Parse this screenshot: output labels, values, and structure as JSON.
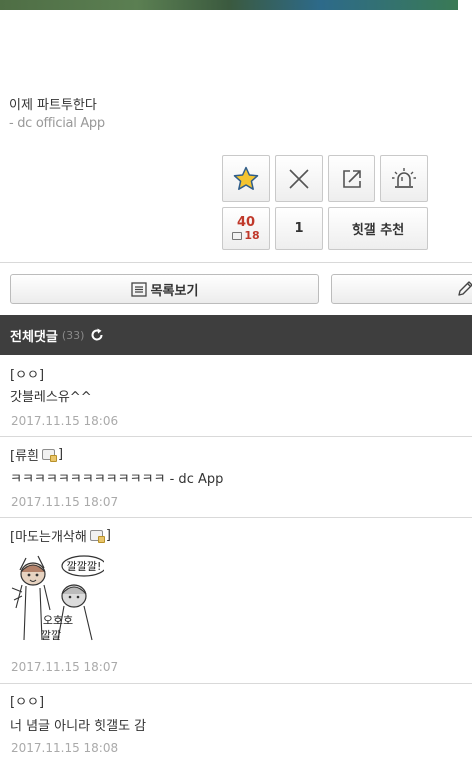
{
  "post": {
    "text": "이제 파트투한다",
    "signature": "- dc official App"
  },
  "vote": {
    "recommend_icon": "star-icon",
    "report_icon": "close-x-icon",
    "share_icon": "share-icon",
    "alert_icon": "siren-icon",
    "recommend_count": "40",
    "fixed_nick_count": "18",
    "nonrecommend_count": "1",
    "hit_recommend_label": "힛갤 추천"
  },
  "actions": {
    "list_label": "목록보기",
    "list_icon": "list-icon",
    "write_icon": "pencil-icon"
  },
  "comments_header": {
    "title": "전체댓글",
    "count": "(33)",
    "refresh_icon": "refresh-icon"
  },
  "comments": [
    {
      "author": "[ㅇㅇ]",
      "text": "갓블레스유^^",
      "date": "2017.11.15 18:06"
    },
    {
      "author": "[류흰",
      "author_suffix": "]",
      "text": "ㅋㅋㅋㅋㅋㅋㅋㅋㅋㅋㅋㅋㅋ - dc App",
      "date": "2017.11.15 18:07"
    },
    {
      "author": "[마도는개삭해",
      "author_suffix": "]",
      "dccon_text_1": "깔깔깔!",
      "dccon_text_2": "오호호",
      "dccon_text_3": "깔깔",
      "date": "2017.11.15 18:07"
    },
    {
      "author": "[ㅇㅇ]",
      "text": "너 념글 아니라 힛갤도 감",
      "date": "2017.11.15 18:08"
    }
  ],
  "colors": {
    "header_bg": "#3e3e3e",
    "vote_red": "#c0392b",
    "date_gray": "#aaaaaa"
  }
}
